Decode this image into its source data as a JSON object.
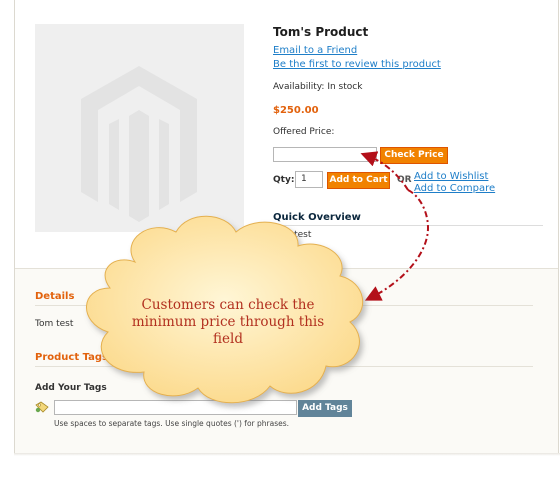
{
  "product": {
    "title": "Tom's Product",
    "email_link": "Email to a Friend",
    "review_link": "Be the first to review this product",
    "availability_label": "Availability:",
    "availability_value": "In stock",
    "price": "$250.00",
    "offered_price_label": "Offered Price:",
    "offered_price_value": "",
    "check_price_button": "Check Price",
    "qty_label": "Qty:",
    "qty_value": "1",
    "add_to_cart_button": "Add to Cart",
    "or_label": "OR",
    "wishlist_link": "Add to Wishlist",
    "compare_link": "Add to Compare",
    "quick_overview_heading": "Quick Overview",
    "quick_overview_text": "Tom test"
  },
  "details": {
    "heading": "Details",
    "text": "Tom test"
  },
  "tags": {
    "heading": "Product Tags",
    "add_label": "Add Your Tags",
    "input_value": "",
    "add_button": "Add Tags",
    "hint": "Use spaces to separate tags. Use single quotes (') for phrases."
  },
  "callout": {
    "text": "Customers can check the minimum price through this field"
  },
  "colors": {
    "accent_orange": "#f18200",
    "price_orange": "#e2620d",
    "link_blue": "#1e7ec8",
    "callout_text": "#b2301f",
    "callout_fill": "#fde7a6",
    "arrow_red": "#b3101a"
  }
}
